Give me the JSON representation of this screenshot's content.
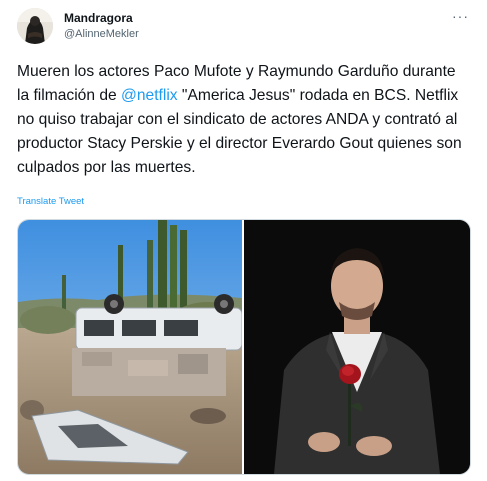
{
  "author": {
    "display_name": "Mandragora",
    "handle": "@AlinneMekler"
  },
  "more_menu": "···",
  "tweet": {
    "text_part1": "Mueren los actores Paco Mufote y Raymundo Garduño durante la filmación de ",
    "mention": "@netflix",
    "text_part2": " \"America Jesus\" rodada en BCS. Netflix no quiso trabajar con el sindicato de actores ANDA y contrató al productor Stacy Perskie y el director Everardo Gout quienes son culpados por las muertes.",
    "translate_label": "Translate Tweet"
  },
  "media": [
    {
      "icon": "overturned-van-photo"
    },
    {
      "icon": "man-with-rose-portrait"
    }
  ],
  "colors": {
    "link": "#1d9bf0",
    "text": "#0f1419",
    "secondary": "#536471",
    "border": "#cfd9de"
  }
}
